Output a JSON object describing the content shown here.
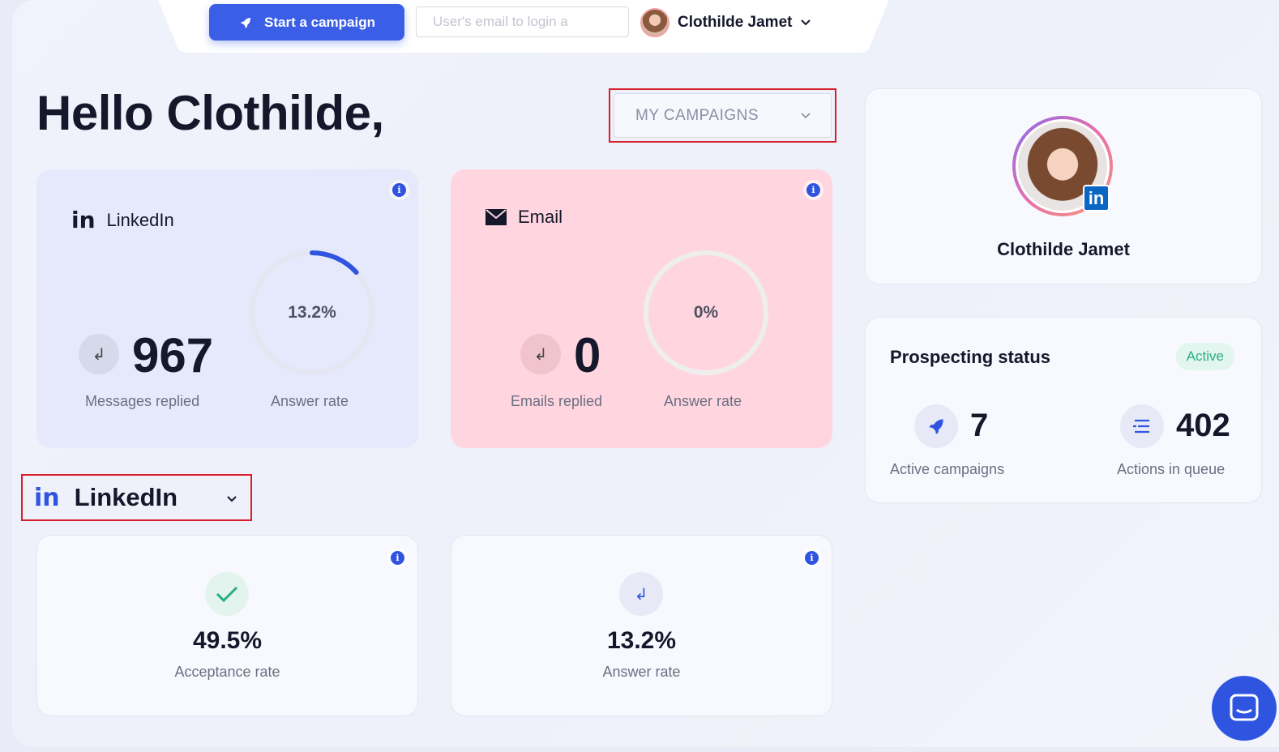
{
  "topbar": {
    "start_campaign_label": "Start a campaign",
    "login_placeholder": "User's email to login a",
    "user_name": "Clothilde Jamet"
  },
  "greeting": "Hello Clothilde,",
  "campaign_filter": {
    "selected": "MY CAMPAIGNS"
  },
  "linkedin_card": {
    "title": "LinkedIn",
    "replied_value": "967",
    "replied_label": "Messages replied",
    "rate_text": "13.2%",
    "rate_fraction": 0.132,
    "rate_label": "Answer rate"
  },
  "email_card": {
    "title": "Email",
    "replied_value": "0",
    "replied_label": "Emails replied",
    "rate_text": "0%",
    "rate_fraction": 0,
    "rate_label": "Answer rate"
  },
  "section_selector": {
    "label": "LinkedIn"
  },
  "acceptance_card": {
    "value": "49.5%",
    "label": "Acceptance rate"
  },
  "answer_card": {
    "value": "13.2%",
    "label": "Answer rate"
  },
  "profile": {
    "name": "Clothilde Jamet",
    "badge": "in"
  },
  "prospecting": {
    "title": "Prospecting status",
    "status": "Active",
    "active_campaigns_value": "7",
    "active_campaigns_label": "Active campaigns",
    "actions_queue_value": "402",
    "actions_queue_label": "Actions in queue"
  },
  "colors": {
    "accent": "#3b5ee6",
    "status_green": "#25b07d",
    "highlight_red": "#d81e2c",
    "email_card_bg": "#ffd6df",
    "linkedin_card_bg": "#e6e9fb"
  }
}
